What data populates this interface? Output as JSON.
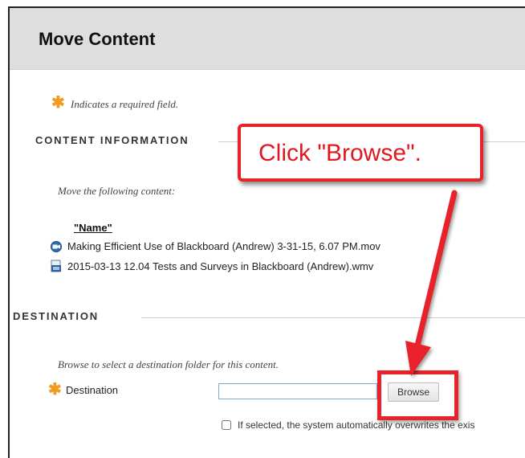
{
  "page": {
    "title": "Move Content",
    "required_note": "Indicates a required field.",
    "required_star": "✱"
  },
  "content_information": {
    "section_title": "CONTENT INFORMATION",
    "instruction": "Move the following content:",
    "items_header": "\"Name\"",
    "items": [
      {
        "name": "Making Efficient Use of Blackboard (Andrew) 3-31-15, 6.07 PM.mov",
        "icon": "video-file-icon"
      },
      {
        "name": "2015-03-13 12.04 Tests and Surveys in Blackboard (Andrew).wmv",
        "icon": "media-file-icon"
      }
    ]
  },
  "destination": {
    "section_title": "DESTINATION",
    "instruction": "Browse to select a destination folder for this content.",
    "field_label": "Destination",
    "field_value": "",
    "browse_label": "Browse",
    "overwrite_label": "If selected, the system automatically overwrites the exis"
  },
  "annotation": {
    "callout_text": "Click \"Browse\".",
    "color": "#e8222a"
  },
  "colors": {
    "header_bg": "#dedede",
    "required_star": "#f19b21",
    "annotation_red": "#e8222a"
  }
}
